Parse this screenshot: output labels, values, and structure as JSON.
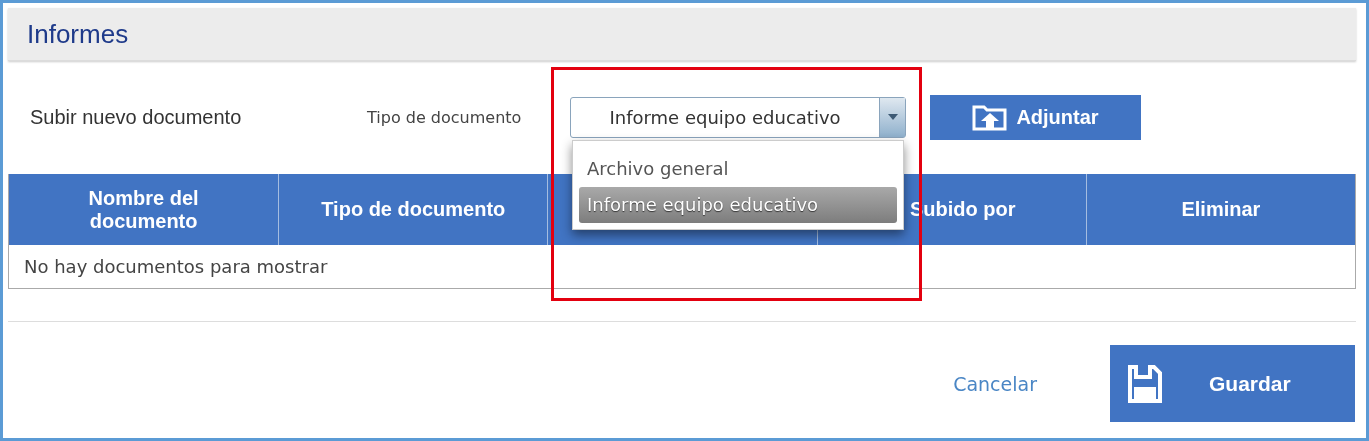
{
  "header": {
    "title": "Informes"
  },
  "upload": {
    "label": "Subir nuevo documento",
    "type_label": "Tipo de documento",
    "type_value": "Informe equipo educativo",
    "attach_button": "Adjuntar",
    "options": [
      {
        "label": "Archivo general",
        "selected": false
      },
      {
        "label": "Informe equipo educativo",
        "selected": true
      }
    ]
  },
  "table": {
    "columns": [
      "Nombre del documento",
      "Tipo de documento",
      "Subido por",
      "Eliminar"
    ],
    "empty_message": "No hay documentos para mostrar"
  },
  "footer": {
    "cancel": "Cancelar",
    "save": "Guardar"
  }
}
